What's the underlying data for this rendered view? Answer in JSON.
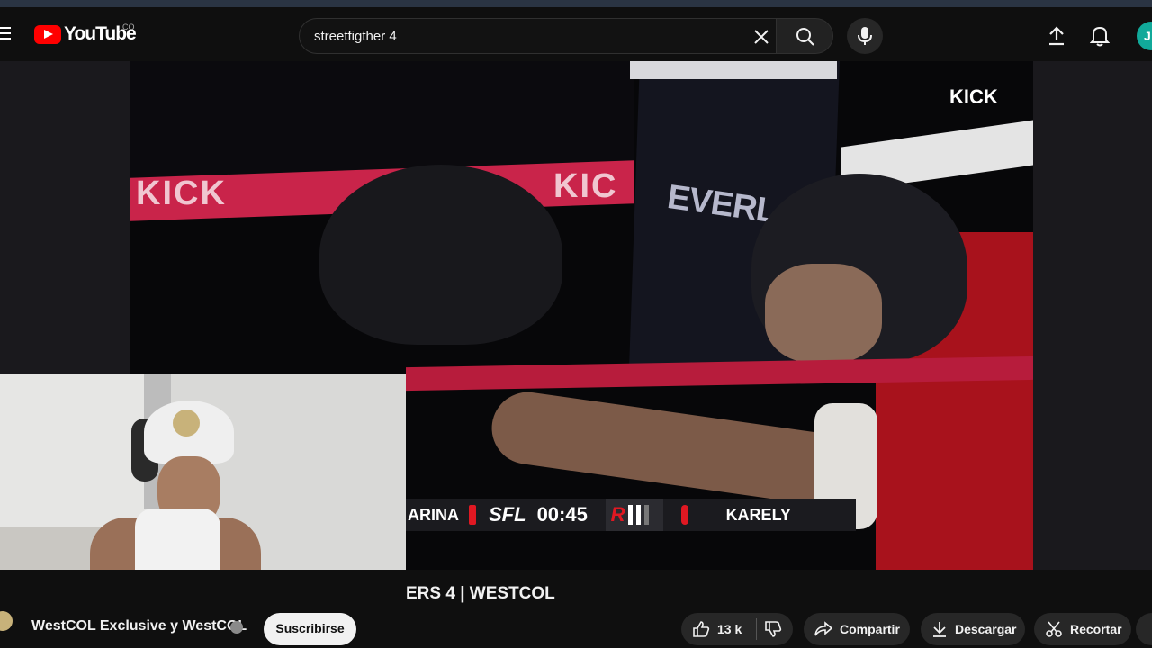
{
  "header": {
    "logo_text": "YouTube",
    "country_code": "CO",
    "search_value": "streetfigther 4",
    "avatar_initial": "J"
  },
  "video": {
    "corner_logo": "KICK",
    "rope_text_left": "KICK",
    "rope_text_right": "KIC",
    "corner_pad_brand": "EVERLA",
    "scoreboard": {
      "left_fighter": "ARINA",
      "logo": "SFL",
      "time": "00:45",
      "round_letter": "R",
      "right_fighter": "KARELY"
    }
  },
  "below": {
    "title": "ERS 4 | WESTCOL",
    "channel_name": "WestCOL Exclusive y WestCOL",
    "subscribe_label": "Suscribirse",
    "like_count": "13 k",
    "share_label": "Compartir",
    "download_label": "Descargar",
    "clip_label": "Recortar"
  },
  "colors": {
    "brand_red": "#ff0000",
    "background": "#0f0f0f",
    "scoreboard_red": "#e01822"
  }
}
